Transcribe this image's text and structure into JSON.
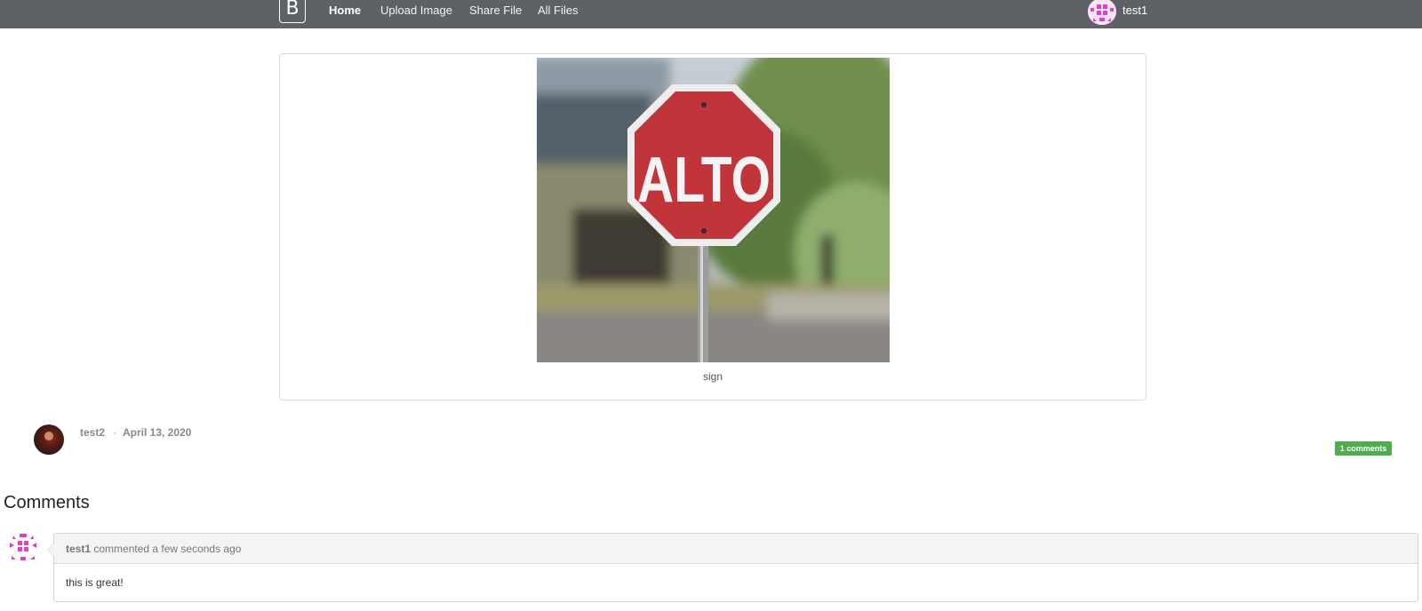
{
  "navbar": {
    "brand": "B",
    "links": [
      {
        "label": "Home",
        "active": true
      },
      {
        "label": "Upload Image",
        "active": false
      },
      {
        "label": "Share File",
        "active": false
      },
      {
        "label": "All Files",
        "active": false
      }
    ],
    "user": "test1",
    "bg_color": "#5e6266"
  },
  "post": {
    "sign_text": "ALTO",
    "caption": "sign",
    "author": "test2",
    "separator": "·",
    "date": "April 13, 2020",
    "comments_badge": "1 comments",
    "badge_color": "#4cae4c"
  },
  "comments": {
    "heading": "Comments",
    "items": [
      {
        "user": "test1",
        "action": "commented a few seconds ago",
        "text": "this is great!"
      }
    ]
  }
}
